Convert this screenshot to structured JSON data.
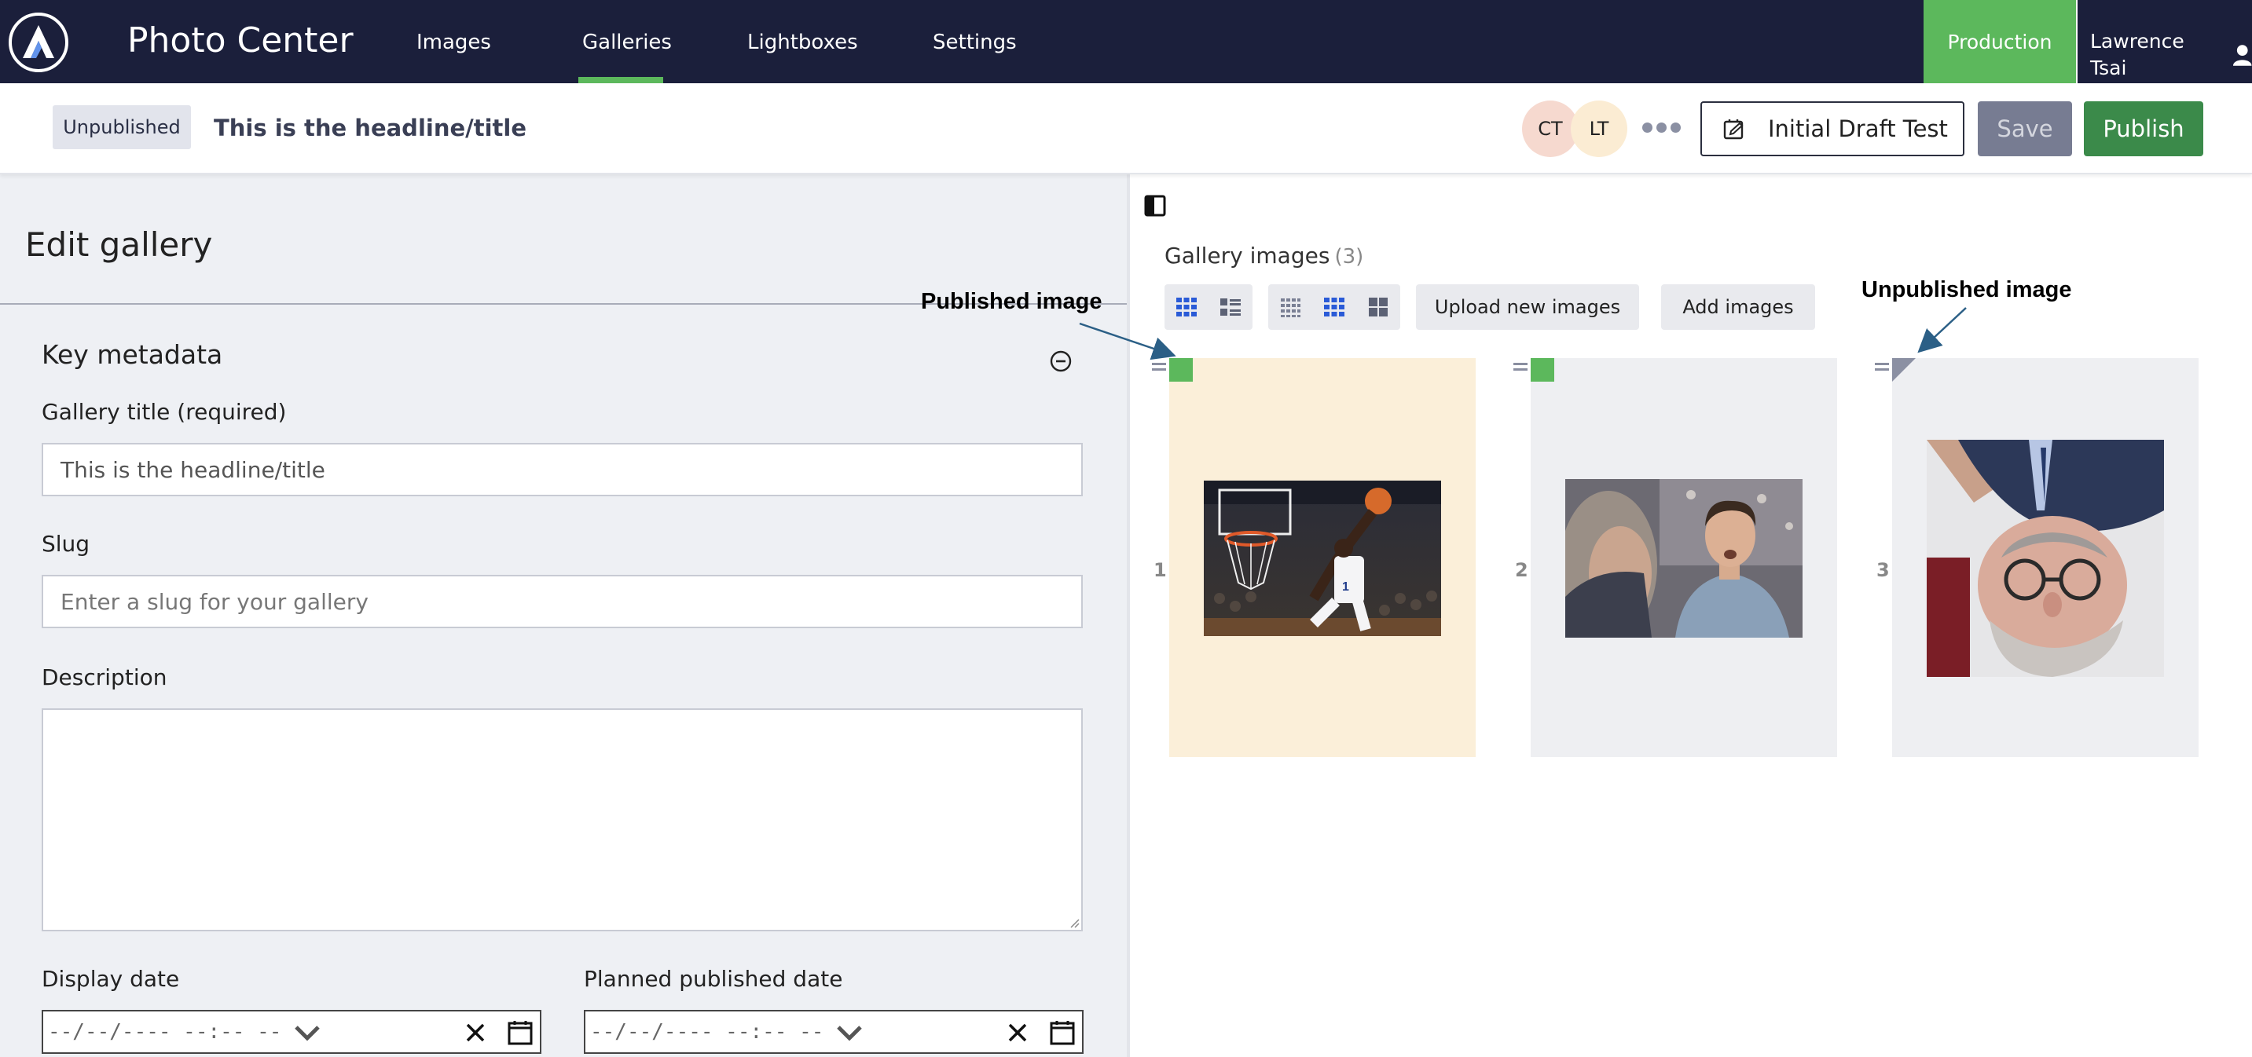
{
  "app": {
    "title": "Photo Center"
  },
  "nav": {
    "items": [
      "Images",
      "Galleries",
      "Lightboxes",
      "Settings"
    ],
    "active": "Galleries"
  },
  "environment": "Production",
  "user": {
    "name": "Lawrence Tsai"
  },
  "status": {
    "badge": "Unpublished",
    "headline": "This is the headline/title"
  },
  "collaborators": [
    "CT",
    "LT"
  ],
  "toolbar": {
    "draft_label": "Initial Draft Test",
    "save_label": "Save",
    "publish_label": "Publish"
  },
  "edit": {
    "title": "Edit gallery",
    "section": "Key metadata",
    "fields": {
      "title_label": "Gallery title (required)",
      "title_value": "This is the headline/title",
      "slug_label": "Slug",
      "slug_placeholder": "Enter a slug for your gallery",
      "description_label": "Description",
      "display_date_label": "Display date",
      "planned_date_label": "Planned published date",
      "date_placeholder": "--/--/---- --:-- --"
    }
  },
  "gallery": {
    "heading": "Gallery images",
    "count": "(3)",
    "upload_label": "Upload new images",
    "add_label": "Add images",
    "images": [
      {
        "number": "1",
        "status": "published",
        "subject": "basketball dunk"
      },
      {
        "number": "2",
        "status": "published",
        "subject": "man speaking with woman"
      },
      {
        "number": "3",
        "status": "unpublished",
        "subject": "man with glasses, rotated"
      }
    ]
  },
  "annotations": {
    "published": "Published image",
    "unpublished": "Unpublished image"
  },
  "colors": {
    "nav_bg": "#1b1f3b",
    "accent_green": "#5cb85c",
    "publish_green": "#3b8a4a",
    "selected_card": "#fbefd9",
    "unpublished_marker": "#8b90a3"
  }
}
